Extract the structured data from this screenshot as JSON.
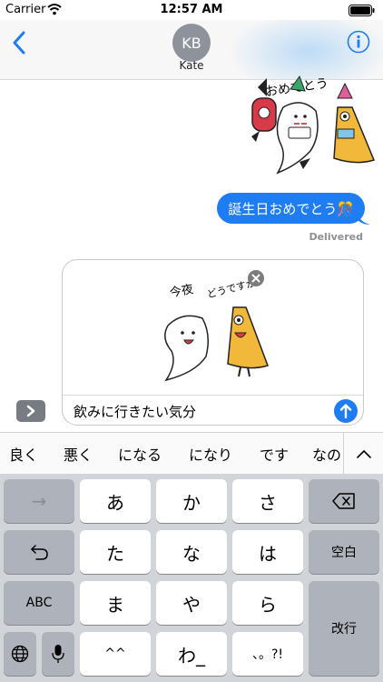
{
  "status_bar": {
    "carrier": "Carrier",
    "time": "12:57 AM"
  },
  "header": {
    "avatar_initials": "KB",
    "contact_name": "Kate"
  },
  "conversation": {
    "sent_message": "誕生日おめでとう🎊",
    "delivery_status": "Delivered",
    "sticker_sent_caption": "おめでとう",
    "sticker_preview_caption_1": "今夜",
    "sticker_preview_caption_2": "どうですか？"
  },
  "composer": {
    "text": "飲みに行きたい気分"
  },
  "predictive": {
    "suggestions": [
      "良く",
      "悪く",
      "になる",
      "になり",
      "です",
      "なの"
    ]
  },
  "keyboard": {
    "row1": [
      "→",
      "あ",
      "か",
      "さ"
    ],
    "row2": [
      "た",
      "な",
      "は",
      "空白"
    ],
    "row3": [
      "ABC",
      "ま",
      "や",
      "ら",
      "改行"
    ],
    "row4": [
      "^^",
      "わ_",
      "、。?!"
    ]
  },
  "colors": {
    "accent": "#1e7df2",
    "keyboard_bg": "#d1d4d9",
    "func_key": "#aeb2ba",
    "avatar": "#8e929b"
  }
}
